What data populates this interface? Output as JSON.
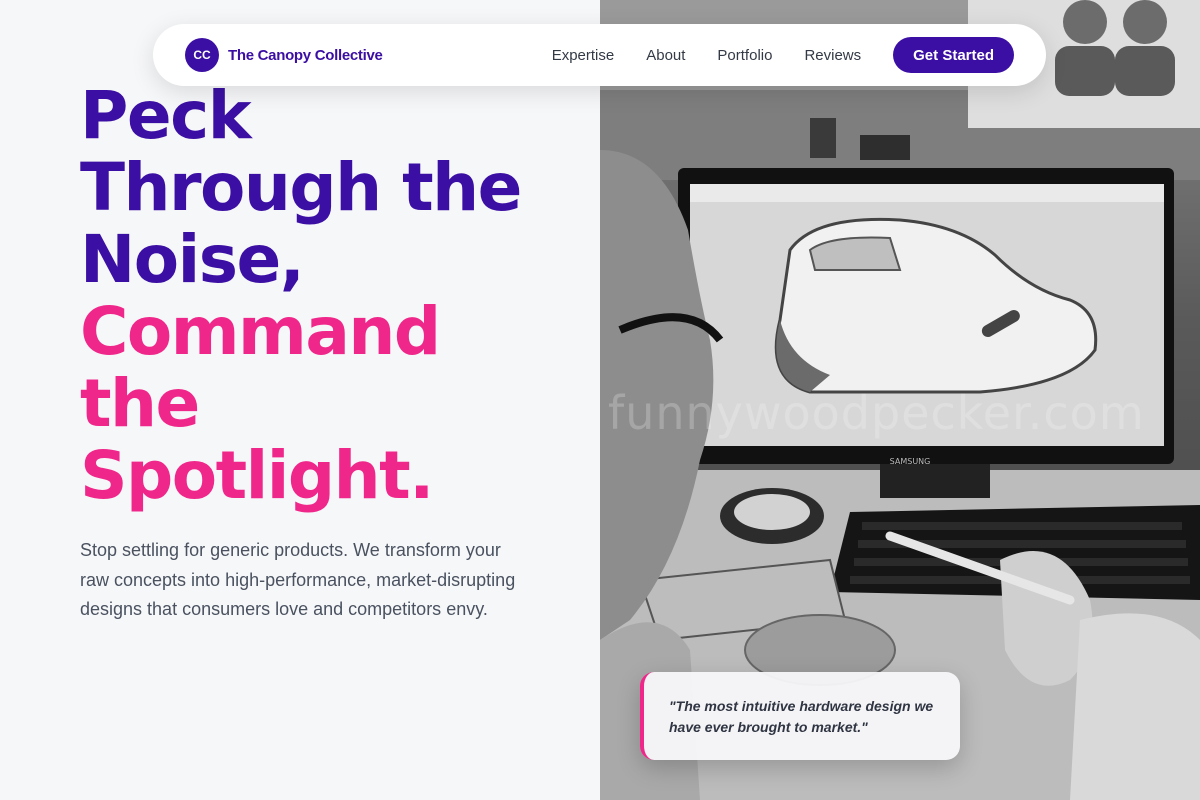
{
  "nav": {
    "logo_mark": "CC",
    "logo_text": "The Canopy Collective",
    "links": [
      "Expertise",
      "About",
      "Portfolio",
      "Reviews"
    ],
    "cta": "Get Started"
  },
  "hero": {
    "headline_purple": [
      "Peck",
      "Through the",
      "Noise,"
    ],
    "headline_pink": [
      "Command",
      "the",
      "Spotlight."
    ],
    "lede": "Stop settling for generic products. We transform your raw concepts into high-performance, market-disrupting designs that consumers love and competitors envy."
  },
  "photo": {
    "watermark": "funnywoodpecker.com",
    "monitor_brand": "SAMSUNG"
  },
  "quote": {
    "text": "\"The most intuitive hardware design we have ever brought to market.\""
  },
  "colors": {
    "brand_purple": "#3b0fa3",
    "accent_pink": "#f0278a",
    "background": "#f6f7f9"
  },
  "icons": [
    "logo-monogram-icon"
  ]
}
